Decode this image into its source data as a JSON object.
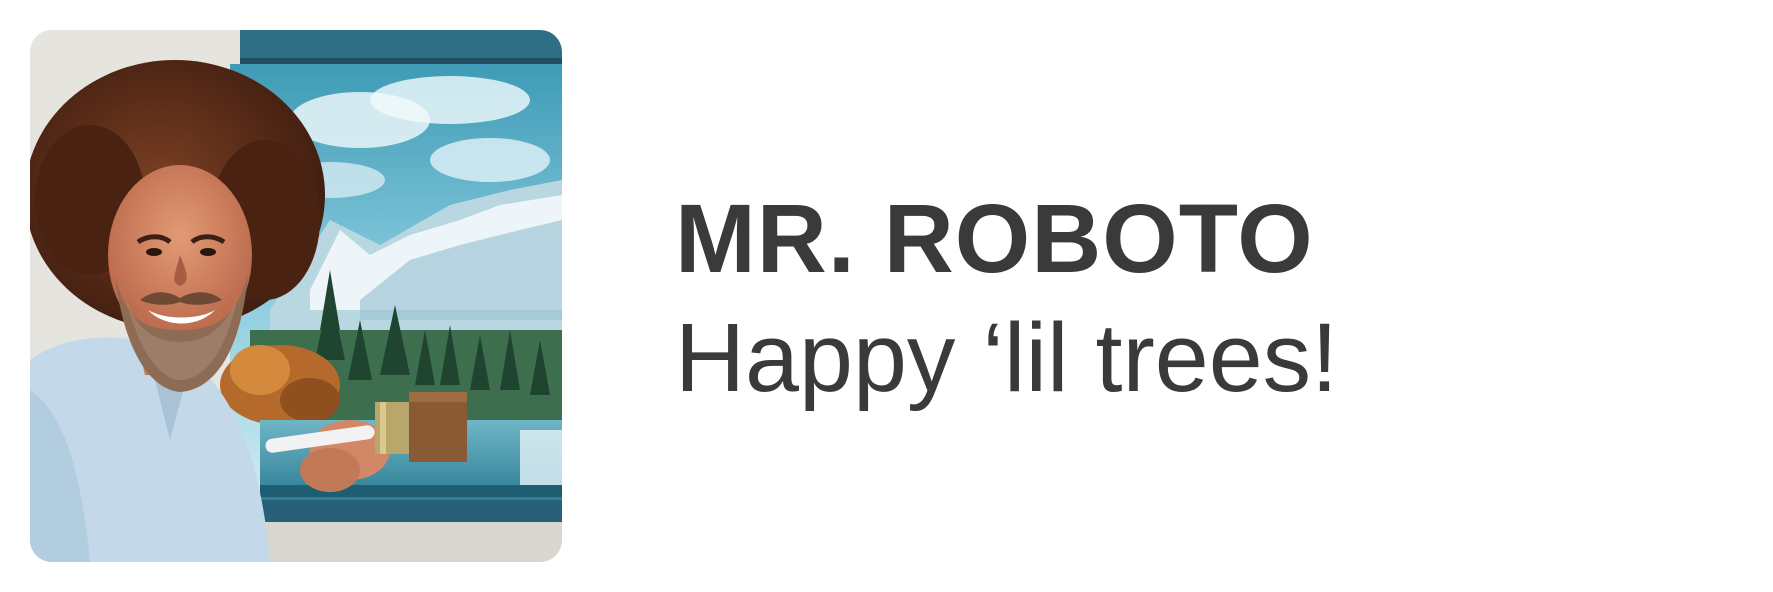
{
  "profile": {
    "name": "MR. ROBOTO",
    "tagline": "Happy ‘lil trees!",
    "avatar_icon": "avatar-photo"
  },
  "colors": {
    "text": "#3a3a3c",
    "background": "#ffffff",
    "sky": "#5fb3c9",
    "mountain": "#e8f1f4",
    "trees": "#2f5a3c",
    "hair": "#5a2c18",
    "shirt": "#c9dcea"
  }
}
